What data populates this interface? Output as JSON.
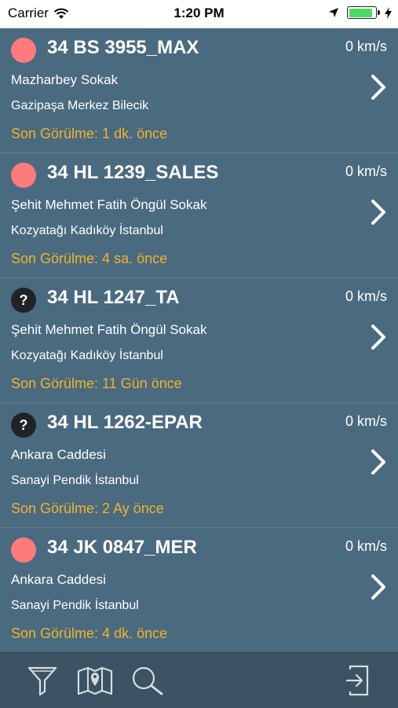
{
  "status_bar": {
    "carrier": "Carrier",
    "time": "1:20 PM",
    "battery_level": 0.9
  },
  "vehicles": [
    {
      "plate": "34 BS 3955_MAX",
      "speed": "0 km/s",
      "street": "Mazharbey Sokak",
      "district": "Gazipaşa Merkez Bilecik",
      "last_seen": "Son Görülme: 1 dk. önce",
      "status": "active",
      "status_color": "#ff7b7b"
    },
    {
      "plate": "34 HL 1239_SALES",
      "speed": "0 km/s",
      "street": "Şehit Mehmet Fatih Öngül Sokak",
      "district": "Kozyatağı Kadıköy İstanbul",
      "last_seen": "Son Görülme: 4 sa. önce",
      "status": "active",
      "status_color": "#ff7b7b"
    },
    {
      "plate": "34 HL 1247_TA",
      "speed": "0 km/s",
      "street": "Şehit Mehmet Fatih Öngül Sokak",
      "district": "Kozyatağı Kadıköy İstanbul",
      "last_seen": "Son Görülme: 11 Gün önce",
      "status": "unknown",
      "status_symbol": "?"
    },
    {
      "plate": "34 HL 1262-EPAR",
      "speed": "0 km/s",
      "street": "Ankara Caddesi",
      "district": "Sanayi Pendik İstanbul",
      "last_seen": "Son Görülme: 2 Ay önce",
      "status": "unknown",
      "status_symbol": "?"
    },
    {
      "plate": "34 JK 0847_MER",
      "speed": "0 km/s",
      "street": "Ankara Caddesi",
      "district": "Sanayi Pendik İstanbul",
      "last_seen": "Son Görülme: 4 dk. önce",
      "status": "active",
      "status_color": "#ff7b7b"
    }
  ],
  "tabbar": {
    "items": [
      {
        "icon": "filter-icon"
      },
      {
        "icon": "map-icon"
      },
      {
        "icon": "search-icon"
      },
      {
        "icon": "logout-icon"
      }
    ]
  },
  "colors": {
    "background": "#4a6a80",
    "accent_last_seen": "#f0b429",
    "tabbar": "#3b5363"
  }
}
